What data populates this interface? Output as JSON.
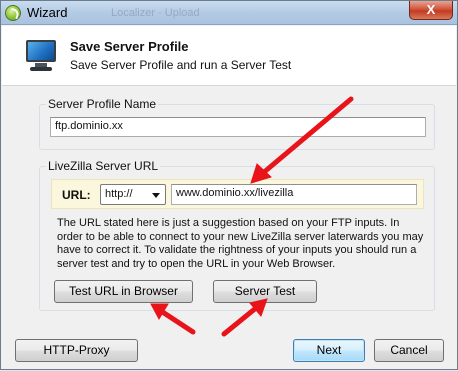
{
  "window": {
    "title": "Wizard",
    "ghost_title": "Localizer · Upload",
    "close_symbol": "X"
  },
  "header": {
    "title": "Save Server Profile",
    "subtitle": "Save Server Profile and run a Server Test",
    "icon": "monitor-icon"
  },
  "profile": {
    "legend": "Server Profile Name",
    "value": "ftp.dominio.xx"
  },
  "server_url": {
    "legend": "LiveZilla Server URL",
    "url_label": "URL:",
    "protocol": "http://",
    "url_value": "www.dominio.xx/livezilla",
    "info": "The URL stated here is just a suggestion based on your FTP inputs. In order to be able to connect to your new LiveZilla server laterwards you may have to correct it. To validate the rightness of your inputs you should run a server test and try to open the URL in your Web Browser.",
    "test_url_button": "Test URL in Browser",
    "server_test_button": "Server Test"
  },
  "footer": {
    "proxy_button": "HTTP-Proxy",
    "next_button": "Next",
    "cancel_button": "Cancel"
  },
  "colors": {
    "annotation_arrow": "#e8141a",
    "url_highlight": "#fbf7dd"
  }
}
